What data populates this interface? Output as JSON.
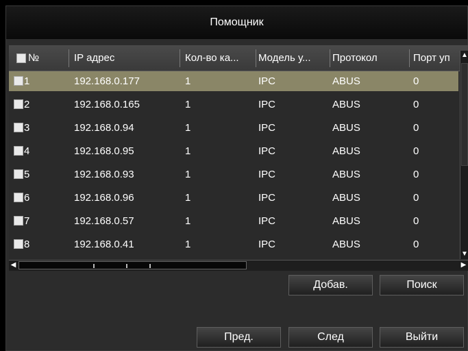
{
  "dialog": {
    "title": "Помощник"
  },
  "table": {
    "columns": [
      "№",
      "IP адрес",
      "Кол-во ка...",
      "Модель у...",
      "Протокол",
      "Порт уп"
    ],
    "rows": [
      {
        "no": "1",
        "ip": "192.168.0.177",
        "count": "1",
        "model": "IPC",
        "protocol": "ABUS",
        "port": "0"
      },
      {
        "no": "2",
        "ip": "192.168.0.165",
        "count": "1",
        "model": "IPC",
        "protocol": "ABUS",
        "port": "0"
      },
      {
        "no": "3",
        "ip": "192.168.0.94",
        "count": "1",
        "model": "IPC",
        "protocol": "ABUS",
        "port": "0"
      },
      {
        "no": "4",
        "ip": "192.168.0.95",
        "count": "1",
        "model": "IPC",
        "protocol": "ABUS",
        "port": "0"
      },
      {
        "no": "5",
        "ip": "192.168.0.93",
        "count": "1",
        "model": "IPC",
        "protocol": "ABUS",
        "port": "0"
      },
      {
        "no": "6",
        "ip": "192.168.0.96",
        "count": "1",
        "model": "IPC",
        "protocol": "ABUS",
        "port": "0"
      },
      {
        "no": "7",
        "ip": "192.168.0.57",
        "count": "1",
        "model": "IPC",
        "protocol": "ABUS",
        "port": "0"
      },
      {
        "no": "8",
        "ip": "192.168.0.41",
        "count": "1",
        "model": "IPC",
        "protocol": "ABUS",
        "port": "0"
      }
    ],
    "selected_row": "1"
  },
  "buttons": {
    "add": "Добав.",
    "search": "Поиск",
    "prev": "Пред.",
    "next": "След",
    "exit": "Выйти"
  },
  "colors": {
    "selected_row": "#8a8667",
    "background": "#2c2c2c",
    "titlebar": "#111111"
  },
  "icons": {
    "scroll_up": "chevron-up-icon",
    "scroll_down": "chevron-down-icon",
    "scroll_left": "chevron-left-icon",
    "scroll_right": "chevron-right-icon"
  }
}
